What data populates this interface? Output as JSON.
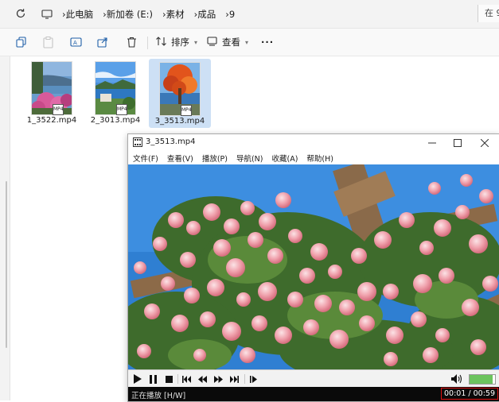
{
  "explorer": {
    "breadcrumb": [
      "此电脑",
      "新加卷 (E:)",
      "素材",
      "成品",
      "9"
    ],
    "search_placeholder": "在 9",
    "toolbar": {
      "sort_label": "排序",
      "view_label": "查看",
      "more_label": "···"
    },
    "files": [
      {
        "name": "1_3522.mp4",
        "thumb": "pink-flowers-lake"
      },
      {
        "name": "2_3013.mp4",
        "thumb": "lake-mountain"
      },
      {
        "name": "3_3513.mp4",
        "thumb": "autumn-tree",
        "selected": true
      }
    ],
    "thumb_badge": "MP4"
  },
  "player": {
    "title": "3_3513.mp4",
    "menu": [
      "文件(F)",
      "查看(V)",
      "播放(P)",
      "导航(N)",
      "收藏(A)",
      "帮助(H)"
    ],
    "status_text": "正在播放 [H/W]",
    "timecode": "00:01 / 00:59",
    "volume_fraction": 0.9,
    "accent_color": "#6cc45e",
    "highlight_color": "#e11111"
  }
}
